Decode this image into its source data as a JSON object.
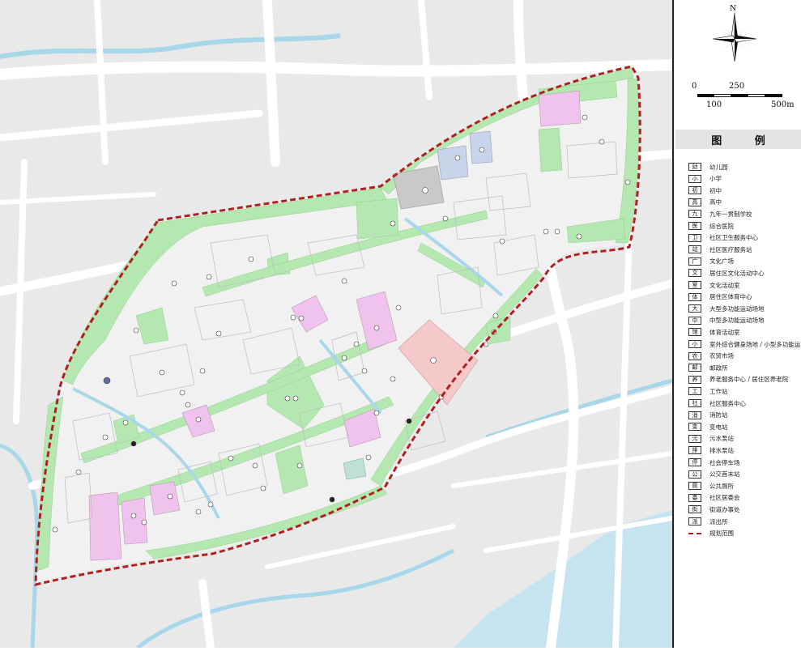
{
  "compass": {
    "north_label": "N",
    "icon": "north-arrow-icon"
  },
  "scale": {
    "label_0": "0",
    "label_250": "250",
    "label_100": "100",
    "label_500": "500m"
  },
  "legend": {
    "title": "图 例",
    "items": [
      {
        "symbol": "幼",
        "label": "幼儿园"
      },
      {
        "symbol": "小",
        "label": "小学"
      },
      {
        "symbol": "初",
        "label": "初中"
      },
      {
        "symbol": "高",
        "label": "高中"
      },
      {
        "symbol": "九",
        "label": "九年一贯制学校"
      },
      {
        "symbol": "医",
        "label": "综合医院"
      },
      {
        "symbol": "卫",
        "label": "社区卫生服务中心"
      },
      {
        "symbol": "站",
        "label": "社区医疗服务站"
      },
      {
        "symbol": "广",
        "label": "文化广场"
      },
      {
        "symbol": "文",
        "label": "居住区文化活动中心"
      },
      {
        "symbol": "室",
        "label": "文化活动室"
      },
      {
        "symbol": "体",
        "label": "居住区体育中心"
      },
      {
        "symbol": "大",
        "label": "大型多功能运动场地"
      },
      {
        "symbol": "中",
        "label": "中型多功能运动场地"
      },
      {
        "symbol": "馆",
        "label": "体育活动室"
      },
      {
        "symbol": "小",
        "label": "室外综合健身场地 / 小型多功能运动场地"
      },
      {
        "symbol": "农",
        "label": "农贸市场"
      },
      {
        "symbol": "邮",
        "label": "邮政所"
      },
      {
        "symbol": "养",
        "label": "养老服务中心 / 居住区养老院"
      },
      {
        "symbol": "工",
        "label": "工作站"
      },
      {
        "symbol": "社",
        "label": "社区服务中心"
      },
      {
        "symbol": "消",
        "label": "消防站"
      },
      {
        "symbol": "变",
        "label": "变电站"
      },
      {
        "symbol": "污",
        "label": "污水泵站"
      },
      {
        "symbol": "排",
        "label": "排水泵站"
      },
      {
        "symbol": "停",
        "label": "社会停车场"
      },
      {
        "symbol": "公",
        "label": "公交首末站"
      },
      {
        "symbol": "厕",
        "label": "公共厕所"
      },
      {
        "symbol": "委",
        "label": "社区居委会"
      },
      {
        "symbol": "街",
        "label": "街道办事处"
      },
      {
        "symbol": "派",
        "label": "派出所"
      },
      {
        "symbol": "",
        "label": "规划范围"
      }
    ]
  },
  "map": {
    "colors": {
      "background": "#e9e9ea",
      "road": "#ffffff",
      "water": "#c5e4f0",
      "river": "#a9d7ea",
      "block": "#f1f1f1",
      "green": "#b4e8b0",
      "commercial": "#f5c9c9",
      "education": "#f0c3ee",
      "residential_gray": "#c9c9c9",
      "blue_block": "#c8d4ec",
      "boundary": "#b02020"
    }
  }
}
